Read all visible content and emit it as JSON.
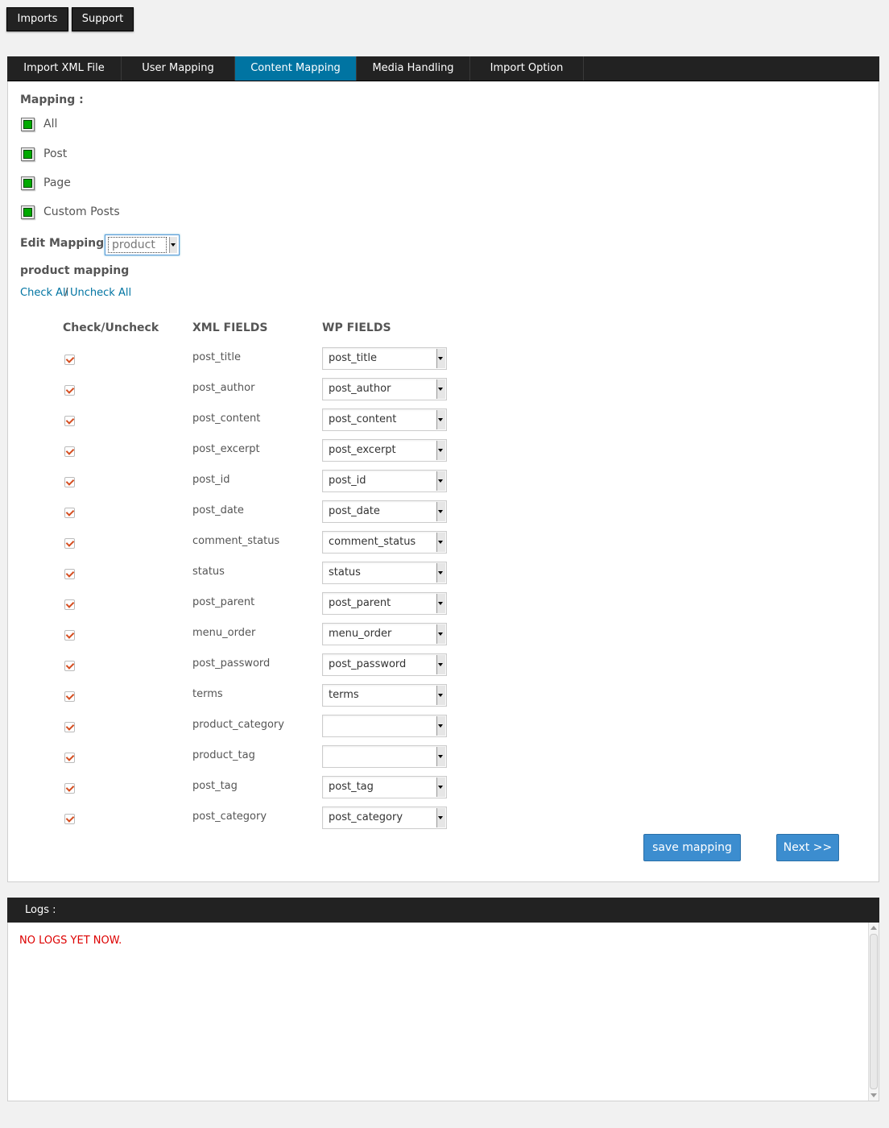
{
  "top_buttons": {
    "imports": "Imports",
    "support": "Support"
  },
  "tabs": [
    {
      "label": "Import XML File"
    },
    {
      "label": "User Mapping"
    },
    {
      "label": "Content Mapping",
      "active": true
    },
    {
      "label": "Media Handling"
    },
    {
      "label": "Import Option"
    }
  ],
  "mapping": {
    "title": "Mapping :",
    "options": [
      {
        "label": "All"
      },
      {
        "label": "Post"
      },
      {
        "label": "Page"
      },
      {
        "label": "Custom Posts"
      }
    ],
    "edit_label": "Edit Mapping",
    "edit_value": "product",
    "section_title": "product mapping",
    "check_all": "Check All",
    "separator": " /",
    "uncheck_all": "Uncheck All"
  },
  "table": {
    "headers": {
      "check": "Check/Uncheck",
      "xml": "XML FIELDS",
      "wp": "WP FIELDS"
    },
    "rows": [
      {
        "xml": "post_title",
        "wp": "post_title",
        "checked": true
      },
      {
        "xml": "post_author",
        "wp": "post_author",
        "checked": true
      },
      {
        "xml": "post_content",
        "wp": "post_content",
        "checked": true
      },
      {
        "xml": "post_excerpt",
        "wp": "post_excerpt",
        "checked": true
      },
      {
        "xml": "post_id",
        "wp": "post_id",
        "checked": true
      },
      {
        "xml": "post_date",
        "wp": "post_date",
        "checked": true
      },
      {
        "xml": "comment_status",
        "wp": "comment_status",
        "checked": true
      },
      {
        "xml": "status",
        "wp": "status",
        "checked": true
      },
      {
        "xml": "post_parent",
        "wp": "post_parent",
        "checked": true
      },
      {
        "xml": "menu_order",
        "wp": "menu_order",
        "checked": true
      },
      {
        "xml": "post_password",
        "wp": "post_password",
        "checked": true
      },
      {
        "xml": "terms",
        "wp": "terms",
        "checked": true
      },
      {
        "xml": "product_category",
        "wp": "",
        "checked": true
      },
      {
        "xml": "product_tag",
        "wp": "",
        "checked": true
      },
      {
        "xml": "post_tag",
        "wp": "post_tag",
        "checked": true
      },
      {
        "xml": "post_category",
        "wp": "post_category",
        "checked": true
      }
    ]
  },
  "actions": {
    "save": "save mapping",
    "next": "Next >>"
  },
  "logs": {
    "title": "Logs :",
    "message": "NO LOGS YET NOW."
  },
  "colors": {
    "tab_active": "#0074a2",
    "button": "#3c8dcf",
    "log_text": "#dd0000",
    "check": "#d54e21"
  }
}
